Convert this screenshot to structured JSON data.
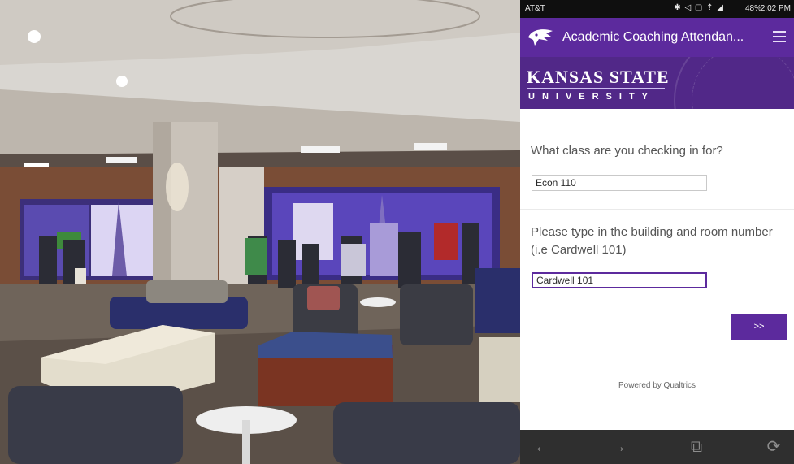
{
  "status_bar": {
    "carrier": "AT&T",
    "indicators": "✱ ◁ ▢ ⇡ ◢",
    "battery": "48%",
    "time": "2:02 PM"
  },
  "app_bar": {
    "title": "Academic Coaching Attendan...",
    "logo_icon": "wildcat-logo-icon",
    "menu_icon": "hamburger-menu-icon",
    "color": "#5c2a9d"
  },
  "banner": {
    "name_line": "KANSAS STATE",
    "university_line": "UNIVERSITY",
    "color": "#512888"
  },
  "form": {
    "question1": "What class are you checking in for?",
    "answer1": "Econ 110",
    "question2": "Please type in the building and room number (i.e Cardwell 101)",
    "answer2": "Cardwell 101",
    "next_label": ">>",
    "powered_by": "Powered by Qualtrics"
  },
  "nav_bar": {
    "back_icon": "back-arrow-icon",
    "forward_icon": "forward-arrow-icon",
    "tabs_icon": "tabs-icon",
    "refresh_icon": "refresh-icon",
    "glyphs": {
      "back": "←",
      "forward": "→",
      "tabs": "⧉",
      "refresh": "⟳"
    }
  }
}
